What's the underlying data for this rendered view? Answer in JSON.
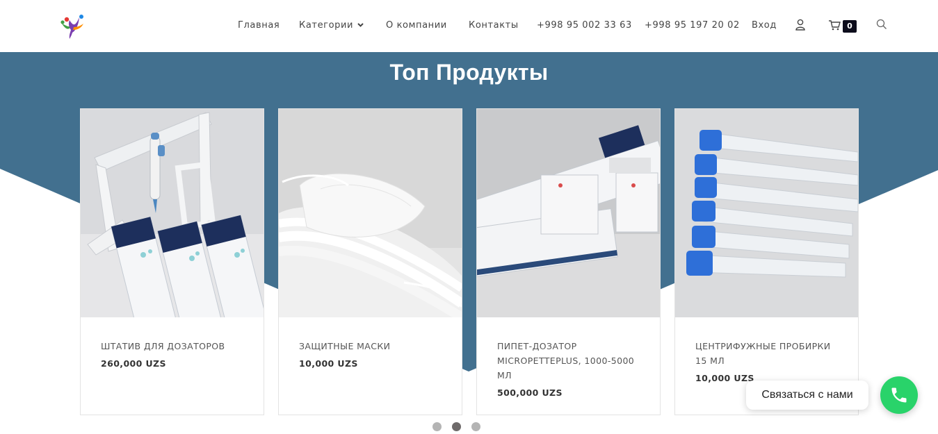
{
  "header": {
    "nav": {
      "home": "Главная",
      "categories": "Категории",
      "about": "О компании",
      "contacts": "Контакты",
      "phone1": "+998 95 002 33 63",
      "phone2": "+998 95 197 20 02",
      "login": "Вход"
    },
    "cart_count": "0",
    "icons": [
      "logo",
      "chevron-down-icon",
      "user-icon",
      "cart-icon",
      "search-icon"
    ]
  },
  "section": {
    "title": "Топ Продукты"
  },
  "products": [
    {
      "name": "ШТАТИВ ДЛЯ ДОЗАТОРОВ",
      "price": "260,000 UZS"
    },
    {
      "name": "ЗАЩИТНЫЕ МАСКИ",
      "price": "10,000 UZS"
    },
    {
      "name": "ПИПЕТ-ДОЗАТОР MICROPETTEPLUS, 1000-5000 МЛ",
      "price": "500,000 UZS"
    },
    {
      "name": "ЦЕНТРИФУЖНЫЕ ПРОБИРКИ 15 МЛ",
      "price": "10,000 UZS"
    }
  ],
  "carousel": {
    "pages": 3,
    "active": 2
  },
  "contact": {
    "label": "Связаться с нами"
  },
  "colors": {
    "band": "#42708f",
    "accent": "#29d36a",
    "badge": "#0d0d1c"
  }
}
